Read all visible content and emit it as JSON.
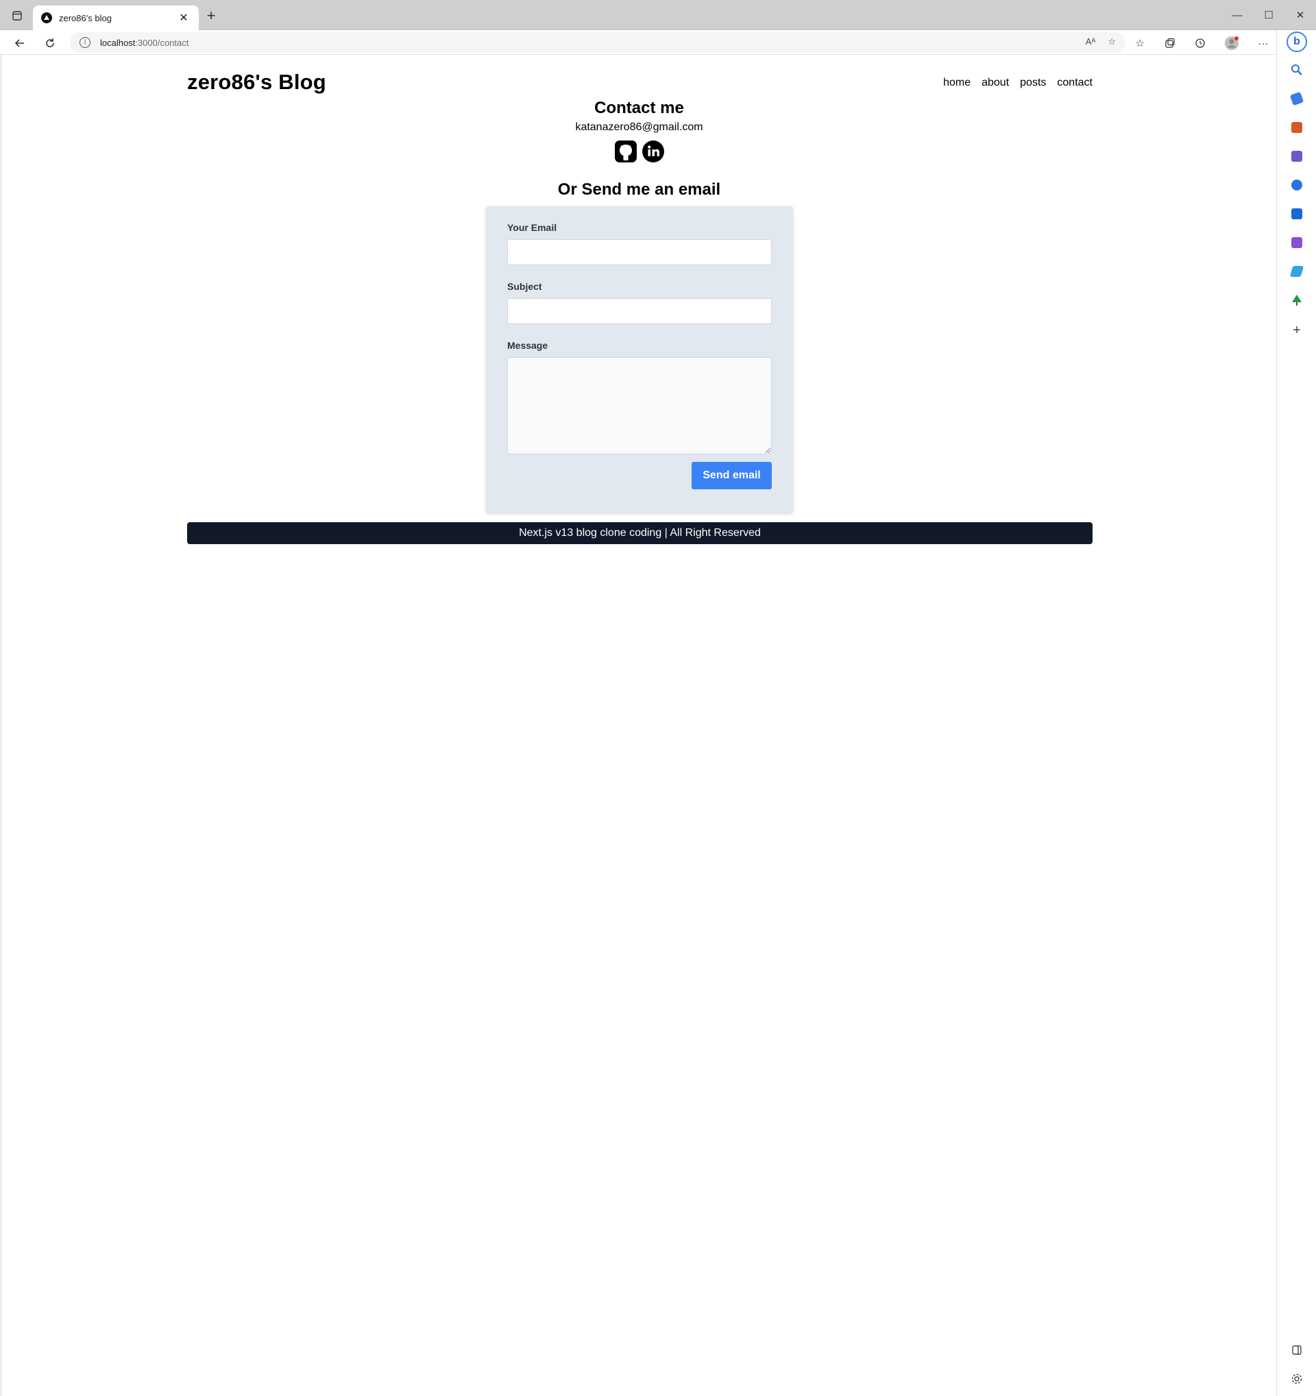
{
  "browser": {
    "tab_title": "zero86's blog",
    "address_host": "localhost",
    "address_path": ":3000/contact",
    "read_aloud_label": "Aᴬ"
  },
  "site": {
    "logo": "zero86's Blog",
    "nav": [
      "home",
      "about",
      "posts",
      "contact"
    ]
  },
  "contact": {
    "title": "Contact me",
    "email": "katanazero86@gmail.com",
    "social_icons": [
      "github-icon",
      "linkedin-icon"
    ],
    "send_title": "Or Send me an email"
  },
  "form": {
    "email_label": "Your Email",
    "email_value": "",
    "subject_label": "Subject",
    "subject_value": "",
    "message_label": "Message",
    "message_value": "",
    "submit_label": "Send email"
  },
  "footer": {
    "text": "Next.js v13 blog clone coding | All Right Reserved"
  },
  "colors": {
    "form_bg": "#e2e8f0",
    "button": "#3b82f6",
    "footer_bg": "#111827"
  }
}
